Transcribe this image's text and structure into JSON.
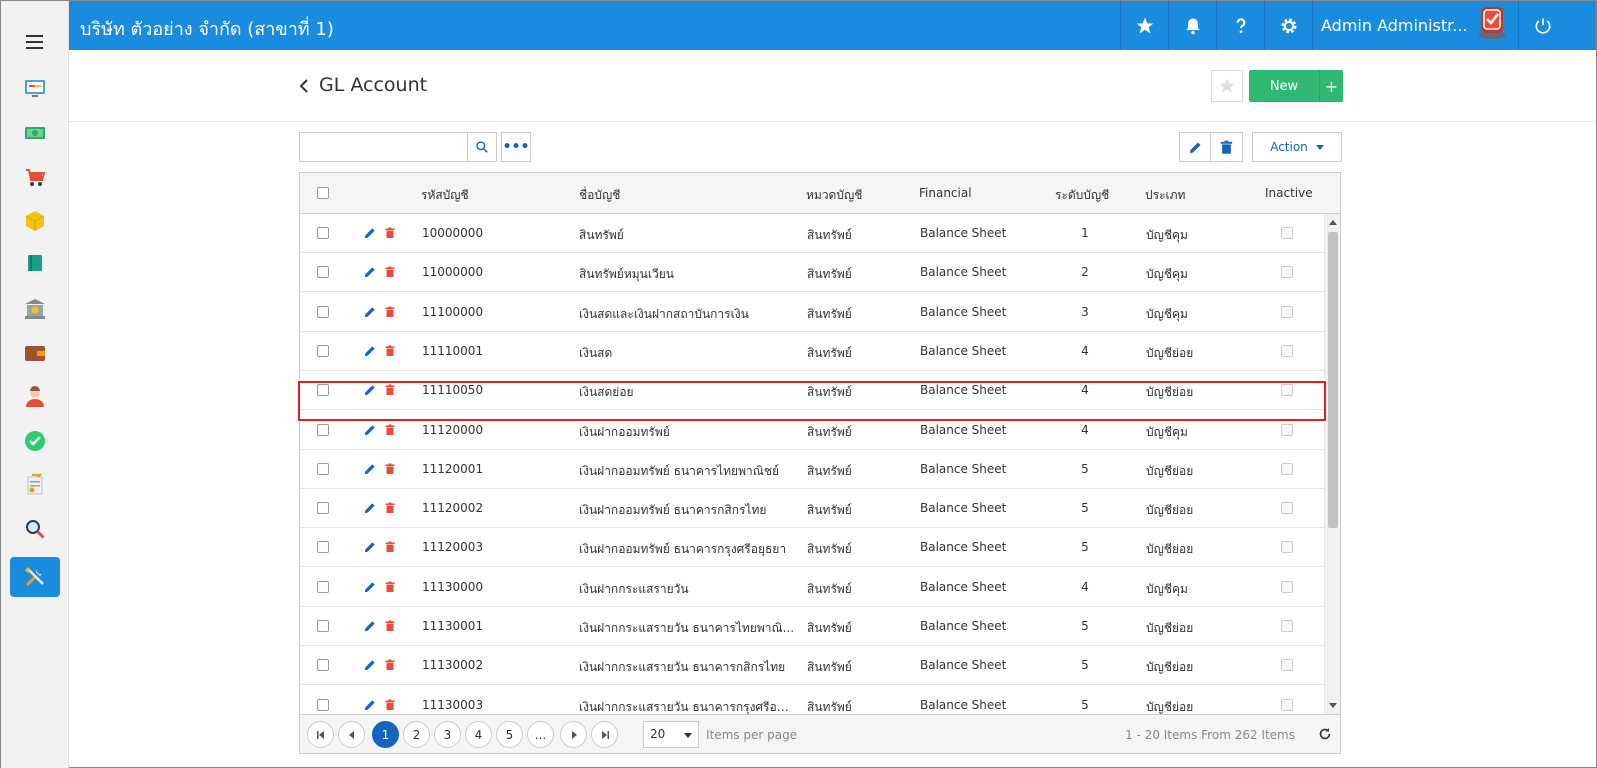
{
  "topbar": {
    "company": "บริษัท ตัวอย่าง จำกัด (สาขาที่ 1)",
    "user_name": "Admin Administr...",
    "accent": "#1a8ce0"
  },
  "sidebar": {
    "items": [
      {
        "icon": "dashboard-icon"
      },
      {
        "icon": "money-icon"
      },
      {
        "icon": "cart-icon"
      },
      {
        "icon": "box-icon"
      },
      {
        "icon": "book-icon"
      },
      {
        "icon": "bank-icon"
      },
      {
        "icon": "wallet-icon"
      },
      {
        "icon": "person-icon"
      },
      {
        "icon": "check-icon"
      },
      {
        "icon": "transfer-icon"
      },
      {
        "icon": "magnifier-icon"
      },
      {
        "icon": "tools-icon",
        "active": true
      }
    ]
  },
  "page": {
    "title": "GL Account",
    "new_label": "New",
    "new_plus": "+",
    "more_label": "•••",
    "action_label": "Action"
  },
  "search": {
    "value": "",
    "placeholder": ""
  },
  "grid": {
    "columns": {
      "code": "รหัสบัญชี",
      "name": "ชื่อบัญชี",
      "category": "หมวดบัญชี",
      "financial": "Financial",
      "level": "ระดับบัญชี",
      "type": "ประเภท",
      "inactive": "Inactive"
    },
    "rows": [
      {
        "code": "10000000",
        "name": "สินทรัพย์",
        "category": "สินทรัพย์",
        "financial": "Balance Sheet",
        "level": "1",
        "type": "บัญชีคุม"
      },
      {
        "code": "11000000",
        "name": "สินทรัพย์หมุนเวียน",
        "category": "สินทรัพย์",
        "financial": "Balance Sheet",
        "level": "2",
        "type": "บัญชีคุม"
      },
      {
        "code": "11100000",
        "name": "เงินสดและเงินฝากสถาบันการเงิน",
        "category": "สินทรัพย์",
        "financial": "Balance Sheet",
        "level": "3",
        "type": "บัญชีคุม"
      },
      {
        "code": "11110001",
        "name": "เงินสด",
        "category": "สินทรัพย์",
        "financial": "Balance Sheet",
        "level": "4",
        "type": "บัญชีย่อย"
      },
      {
        "code": "11110050",
        "name": "เงินสดย่อย",
        "category": "สินทรัพย์",
        "financial": "Balance Sheet",
        "level": "4",
        "type": "บัญชีย่อย"
      },
      {
        "code": "11120000",
        "name": "เงินฝากออมทรัพย์",
        "category": "สินทรัพย์",
        "financial": "Balance Sheet",
        "level": "4",
        "type": "บัญชีคุม"
      },
      {
        "code": "11120001",
        "name": "เงินฝากออมทรัพย์ ธนาคารไทยพาณิชย์",
        "category": "สินทรัพย์",
        "financial": "Balance Sheet",
        "level": "5",
        "type": "บัญชีย่อย"
      },
      {
        "code": "11120002",
        "name": "เงินฝากออมทรัพย์ ธนาคารกสิกรไทย",
        "category": "สินทรัพย์",
        "financial": "Balance Sheet",
        "level": "5",
        "type": "บัญชีย่อย"
      },
      {
        "code": "11120003",
        "name": "เงินฝากออมทรัพย์ ธนาคารกรุงศรีอยุธยา",
        "category": "สินทรัพย์",
        "financial": "Balance Sheet",
        "level": "5",
        "type": "บัญชีย่อย"
      },
      {
        "code": "11130000",
        "name": "เงินฝากกระแสรายวัน",
        "category": "สินทรัพย์",
        "financial": "Balance Sheet",
        "level": "4",
        "type": "บัญชีคุม"
      },
      {
        "code": "11130001",
        "name": "เงินฝากกระแสรายวัน ธนาคารไทยพาณิ...",
        "category": "สินทรัพย์",
        "financial": "Balance Sheet",
        "level": "5",
        "type": "บัญชีย่อย"
      },
      {
        "code": "11130002",
        "name": "เงินฝากกระแสรายวัน ธนาคารกสิกรไทย",
        "category": "สินทรัพย์",
        "financial": "Balance Sheet",
        "level": "5",
        "type": "บัญชีย่อย"
      },
      {
        "code": "11130003",
        "name": "เงินฝากกระแสรายวัน ธนาคารกรุงศรีอยุ...",
        "category": "สินทรัพย์",
        "financial": "Balance Sheet",
        "level": "5",
        "type": "บัญชีย่อย"
      }
    ]
  },
  "pager": {
    "pages": [
      "1",
      "2",
      "3",
      "4",
      "5",
      "..."
    ],
    "current": "1",
    "page_size": "20",
    "items_per_page": "Items per page",
    "info": "1 - 20 Items From 262 Items"
  }
}
